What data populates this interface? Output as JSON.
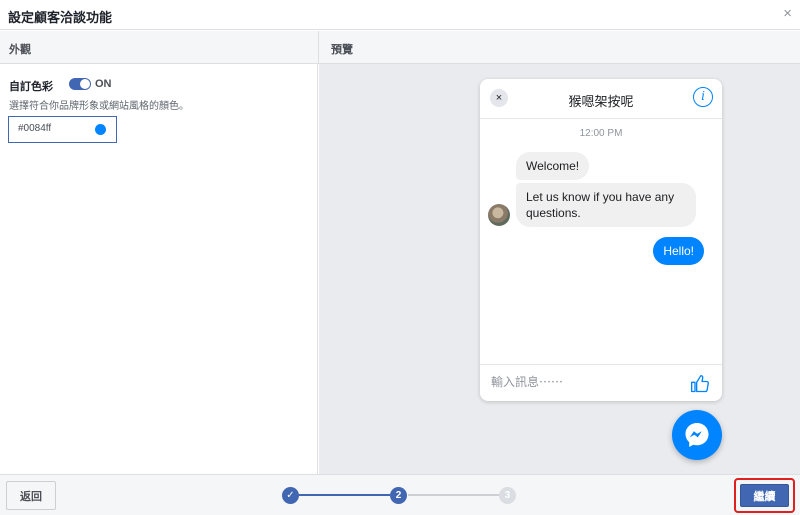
{
  "dialog": {
    "title": "設定顧客洽談功能",
    "close_glyph": "×"
  },
  "sections": {
    "appearance": "外觀",
    "preview": "預覽"
  },
  "custom_color": {
    "label": "自訂色彩",
    "toggle_state": "ON",
    "helper": "選擇符合你品牌形象或網站風格的顏色。",
    "value": "#0084ff",
    "accent": "#0084ff"
  },
  "chat_preview": {
    "title": "猴嗯架按呢",
    "close_glyph": "×",
    "info_glyph": "i",
    "time": "12:00 PM",
    "messages_in": [
      "Welcome!",
      "Let us know if you have any questions."
    ],
    "message_out": "Hello!",
    "composer_placeholder": "輸入訊息⋯⋯",
    "like_icon": "thumbs-up-icon",
    "launcher_icon": "messenger-icon"
  },
  "footer": {
    "back_label": "返回",
    "continue_label": "繼續",
    "steps": [
      {
        "label": "✓",
        "state": "done"
      },
      {
        "label": "2",
        "state": "current"
      },
      {
        "label": "3",
        "state": "pending"
      }
    ]
  },
  "colors": {
    "brand": "#4267b2",
    "messenger": "#0084ff",
    "highlight": "#e02020"
  }
}
